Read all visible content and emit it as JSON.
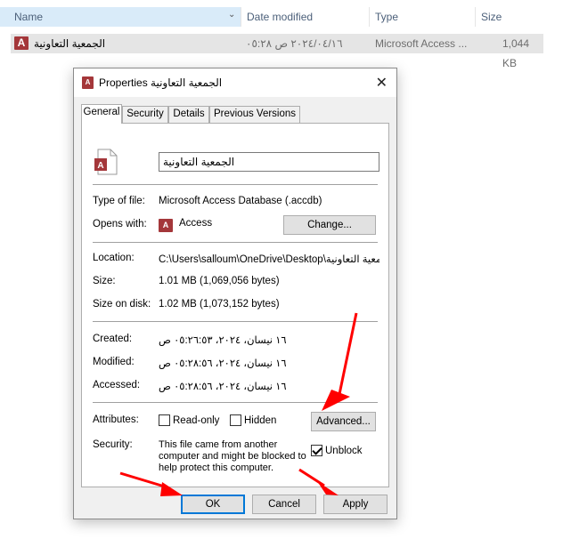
{
  "explorer": {
    "columns": {
      "name": "Name",
      "date_modified": "Date modified",
      "type": "Type",
      "size": "Size"
    },
    "file": {
      "name": "الجمعية التعاونية",
      "date": "٢٠٢٤/٠٤/١٦ ص ٠٥:٢٨",
      "type": "Microsoft Access ...",
      "size": "1,044 KB",
      "icon": "access-file-icon"
    }
  },
  "dialog": {
    "title": "الجمعية التعاونية Properties",
    "close_glyph": "✕",
    "tabs": [
      "General",
      "Security",
      "Details",
      "Previous Versions"
    ],
    "active_tab": "General",
    "file_name": "الجمعية التعاونية",
    "type_of_file": {
      "label": "Type of file:",
      "value": "Microsoft Access Database (.accdb)"
    },
    "opens_with": {
      "label": "Opens with:",
      "value": "Access",
      "change_label": "Change..."
    },
    "location": {
      "label": "Location:",
      "value": "C:\\Users\\salloum\\OneDrive\\Desktop\\الجمعية التعاونية"
    },
    "size": {
      "label": "Size:",
      "value": "1.01 MB (1,069,056 bytes)"
    },
    "size_on_disk": {
      "label": "Size on disk:",
      "value": "1.02 MB (1,073,152 bytes)"
    },
    "created": {
      "label": "Created:",
      "value": "١٦ نيسان، ٢٠٢٤، ٠٥:٢٦:٥٣ ص"
    },
    "modified": {
      "label": "Modified:",
      "value": "١٦ نيسان، ٢٠٢٤، ٠٥:٢٨:٥٦ ص"
    },
    "accessed": {
      "label": "Accessed:",
      "value": "١٦ نيسان، ٢٠٢٤، ٠٥:٢٨:٥٦ ص"
    },
    "attributes": {
      "label": "Attributes:",
      "read_only": {
        "label": "Read-only",
        "checked": false
      },
      "hidden": {
        "label": "Hidden",
        "checked": false
      },
      "advanced_label": "Advanced..."
    },
    "security": {
      "label": "Security:",
      "message_line1": "This file came from another",
      "message_line2": "computer and might be blocked to",
      "message_line3": "help protect this computer.",
      "unblock": {
        "label": "Unblock",
        "checked": true
      }
    },
    "buttons": {
      "ok": "OK",
      "cancel": "Cancel",
      "apply": "Apply"
    }
  },
  "annotation_color": "#ff0000"
}
